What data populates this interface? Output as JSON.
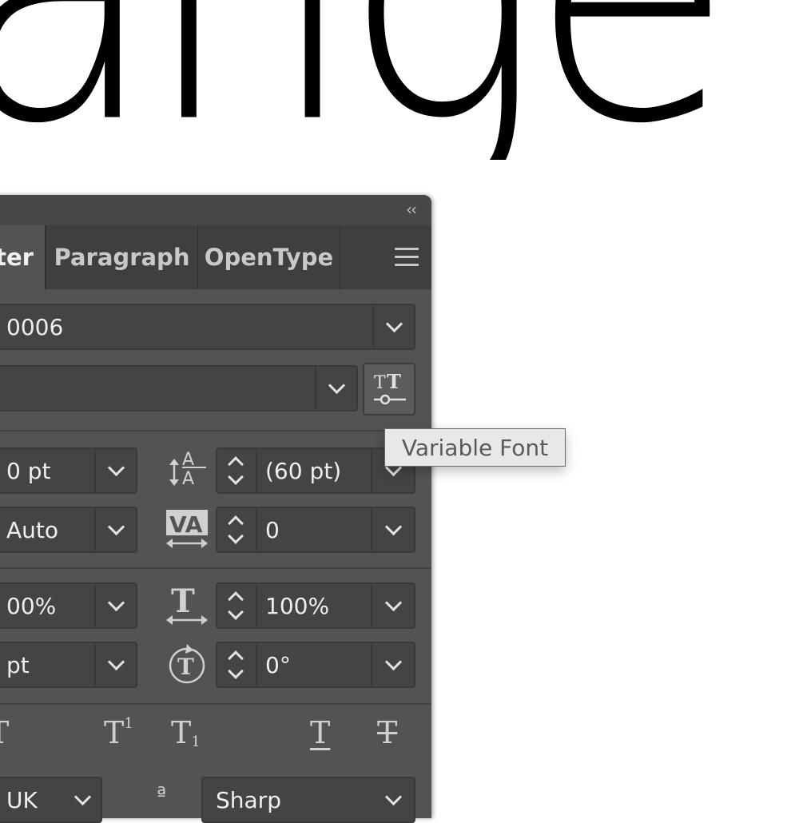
{
  "canvas": {
    "word": "ange"
  },
  "panel": {
    "collapse_icon": "double-chevron-left-icon",
    "tabs": [
      {
        "label": "ter",
        "active": true
      },
      {
        "label": "Paragraph",
        "active": false
      },
      {
        "label": "OpenType",
        "active": false
      }
    ],
    "menu_icon": "hamburger-menu-icon",
    "font_family": "0006",
    "font_style": "",
    "font_size": "0 pt",
    "leading": "(60 pt)",
    "kerning": "Auto",
    "tracking": "0",
    "vertical_scale": "00%",
    "horizontal_scale": "100%",
    "baseline_shift": "pt",
    "rotation": "0°",
    "language": "UK",
    "antialias": "Sharp"
  },
  "tooltip": {
    "text": "Variable Font"
  },
  "colors": {
    "panel": "#535353",
    "tabbar": "#3f3f3f",
    "field": "#444444",
    "tooltip_bg": "#e8e8e8"
  }
}
